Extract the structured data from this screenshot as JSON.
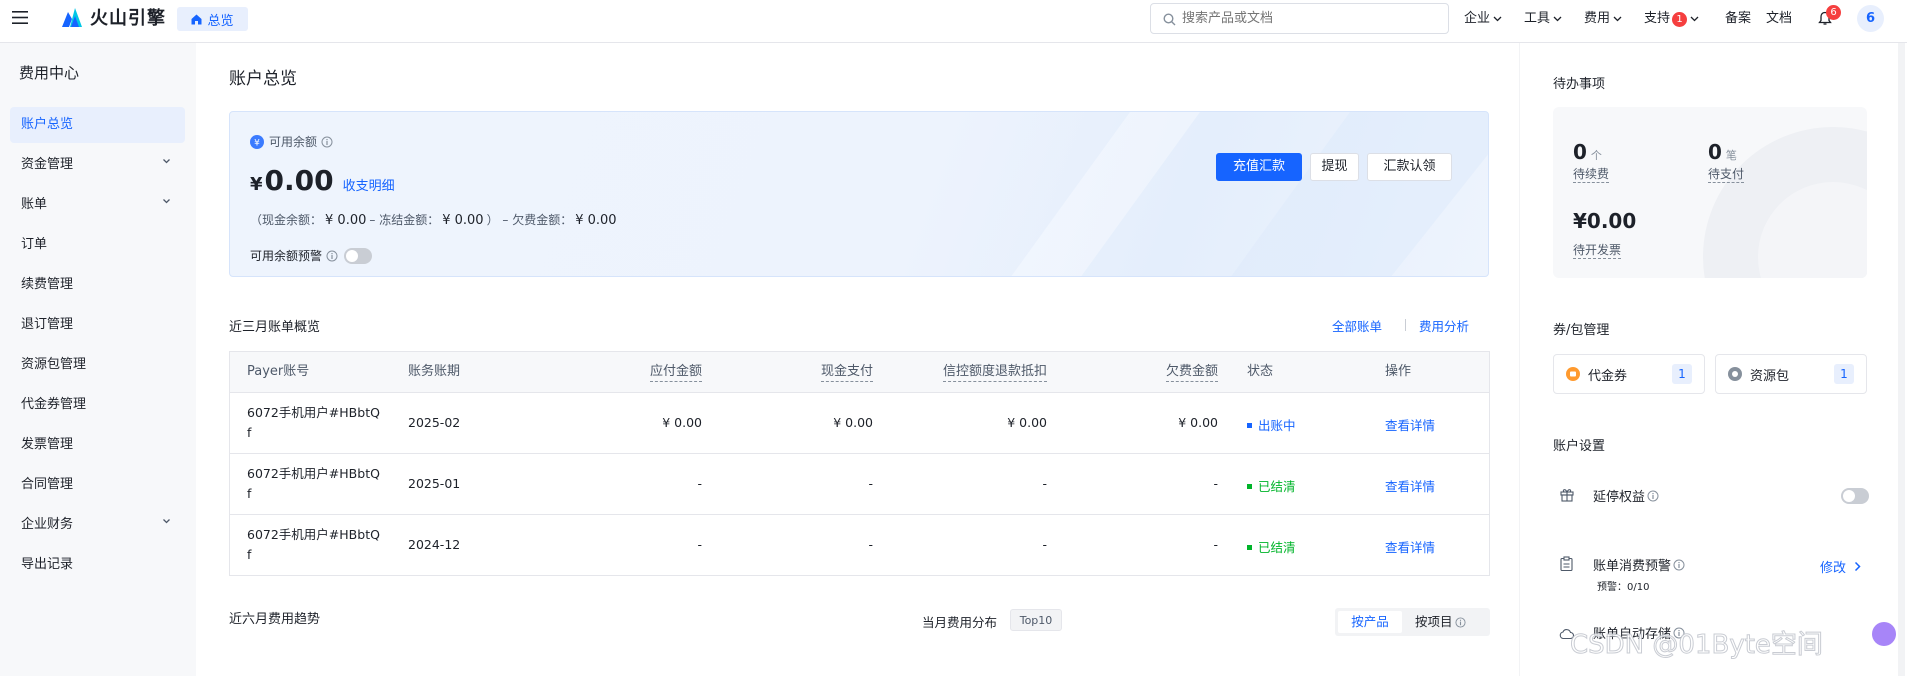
{
  "topbar": {
    "logo_text": "火山引擎",
    "home_tab": "总览",
    "search_placeholder": "搜索产品或文档",
    "nav": {
      "enterprise": "企业",
      "tools": "工具",
      "fees": "费用",
      "support": "支持",
      "support_badge": "1",
      "filing": "备案",
      "docs": "文档",
      "notif_badge": "6",
      "avatar": "6"
    }
  },
  "sidebar": {
    "title": "费用中心",
    "items": [
      {
        "label": "账户总览"
      },
      {
        "label": "资金管理"
      },
      {
        "label": "账单"
      },
      {
        "label": "订单"
      },
      {
        "label": "续费管理"
      },
      {
        "label": "退订管理"
      },
      {
        "label": "资源包管理"
      },
      {
        "label": "代金券管理"
      },
      {
        "label": "发票管理"
      },
      {
        "label": "合同管理"
      },
      {
        "label": "企业财务"
      },
      {
        "label": "导出记录"
      }
    ]
  },
  "page": {
    "title": "账户总览"
  },
  "balance": {
    "label": "可用余额",
    "currency": "¥",
    "amount": "0.00",
    "detail_link": "收支明细",
    "cash_label": "（现金余额：",
    "cash_value": "¥ 0.00",
    "frozen_label": "– 冻结金额：",
    "frozen_value": "¥ 0.00",
    "owe_label": "） – 欠费金额：",
    "owe_value": "¥ 0.00",
    "alert_label": "可用余额预警",
    "btn_recharge": "充值汇款",
    "btn_withdraw": "提现",
    "btn_claim": "汇款认领"
  },
  "bills": {
    "title": "近三月账单概览",
    "link_all": "全部账单",
    "link_analysis": "费用分析",
    "columns": [
      "Payer账号",
      "账务账期",
      "应付金额",
      "现金支付",
      "信控额度退款抵扣",
      "欠费金额",
      "状态",
      "操作"
    ],
    "rows": [
      {
        "payer1": "6072手机用户#HBbtQ",
        "payer2": "f",
        "period": "2025-02",
        "payable": "¥ 0.00",
        "cash": "¥ 0.00",
        "credit": "¥ 0.00",
        "owe": "¥ 0.00",
        "status": "出账中",
        "status_color": "#1664ff",
        "action": "查看详情"
      },
      {
        "payer1": "6072手机用户#HBbtQ",
        "payer2": "f",
        "period": "2025-01",
        "payable": "-",
        "cash": "-",
        "credit": "-",
        "owe": "-",
        "status": "已结清",
        "status_color": "#00b42a",
        "action": "查看详情"
      },
      {
        "payer1": "6072手机用户#HBbtQ",
        "payer2": "f",
        "period": "2024-12",
        "payable": "-",
        "cash": "-",
        "credit": "-",
        "owe": "-",
        "status": "已结清",
        "status_color": "#00b42a",
        "action": "查看详情"
      }
    ]
  },
  "trend": {
    "title": "近六月费用趋势",
    "dist_label": "当月费用分布",
    "top_badge": "Top10",
    "tab_product": "按产品",
    "tab_project": "按项目"
  },
  "todo": {
    "title": "待办事项",
    "renew_count": "0",
    "renew_unit": "个",
    "renew_label": "待续费",
    "pay_count": "0",
    "pay_unit": "笔",
    "pay_label": "待支付",
    "invoice_amount": "¥0.00",
    "invoice_label": "待开发票"
  },
  "coupons": {
    "title": "券/包管理",
    "voucher_label": "代金券",
    "voucher_count": "1",
    "package_label": "资源包",
    "package_count": "1"
  },
  "settings": {
    "title": "账户设置",
    "delay_label": "延停权益",
    "alarm_label": "账单消费预警",
    "alarm_sub": "预警：0/10",
    "alarm_edit": "修改",
    "auto_label": "账单自动存储"
  },
  "watermark": "CSDN @01Byte空间",
  "colors": {
    "primary": "#1664ff",
    "success": "#00b42a",
    "danger": "#f53f3f",
    "card_bg": "#edf3fd"
  }
}
